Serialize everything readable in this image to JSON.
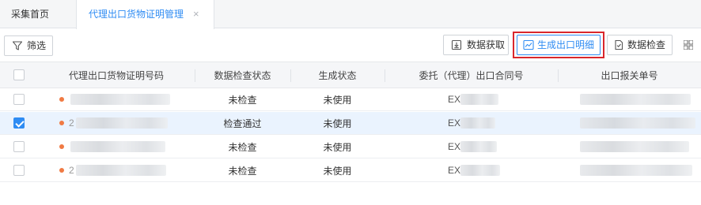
{
  "tabs": [
    {
      "label": "采集首页",
      "active": false
    },
    {
      "label": "代理出口货物证明管理",
      "active": true,
      "close": "×"
    }
  ],
  "toolbar": {
    "filter_label": "筛选",
    "fetch_label": "数据获取",
    "generate_label": "生成出口明细",
    "check_label": "数据检查",
    "highlight_color": "#d9262c",
    "accent_color": "#2f8cf3"
  },
  "table": {
    "columns": [
      "代理出口货物证明号码",
      "数据检查状态",
      "生成状态",
      "委托（代理）出口合同号",
      "出口报关单号"
    ],
    "rows": [
      {
        "checked": false,
        "cert_prefix": "",
        "check_status": "未检查",
        "gen_status": "未使用",
        "contract_prefix": "EX"
      },
      {
        "checked": true,
        "cert_prefix": "2",
        "check_status": "检查通过",
        "gen_status": "未使用",
        "contract_prefix": "EX"
      },
      {
        "checked": false,
        "cert_prefix": "",
        "check_status": "未检查",
        "gen_status": "未使用",
        "contract_prefix": "EX"
      },
      {
        "checked": false,
        "cert_prefix": "2",
        "check_status": "未检查",
        "gen_status": "未使用",
        "contract_prefix": "EX"
      }
    ]
  },
  "icons": {
    "filter": "filter-icon",
    "fetch": "download-icon",
    "generate": "chart-line-icon",
    "check": "check-document-icon",
    "grid": "grid-icon",
    "status_dot": "dot-icon"
  }
}
